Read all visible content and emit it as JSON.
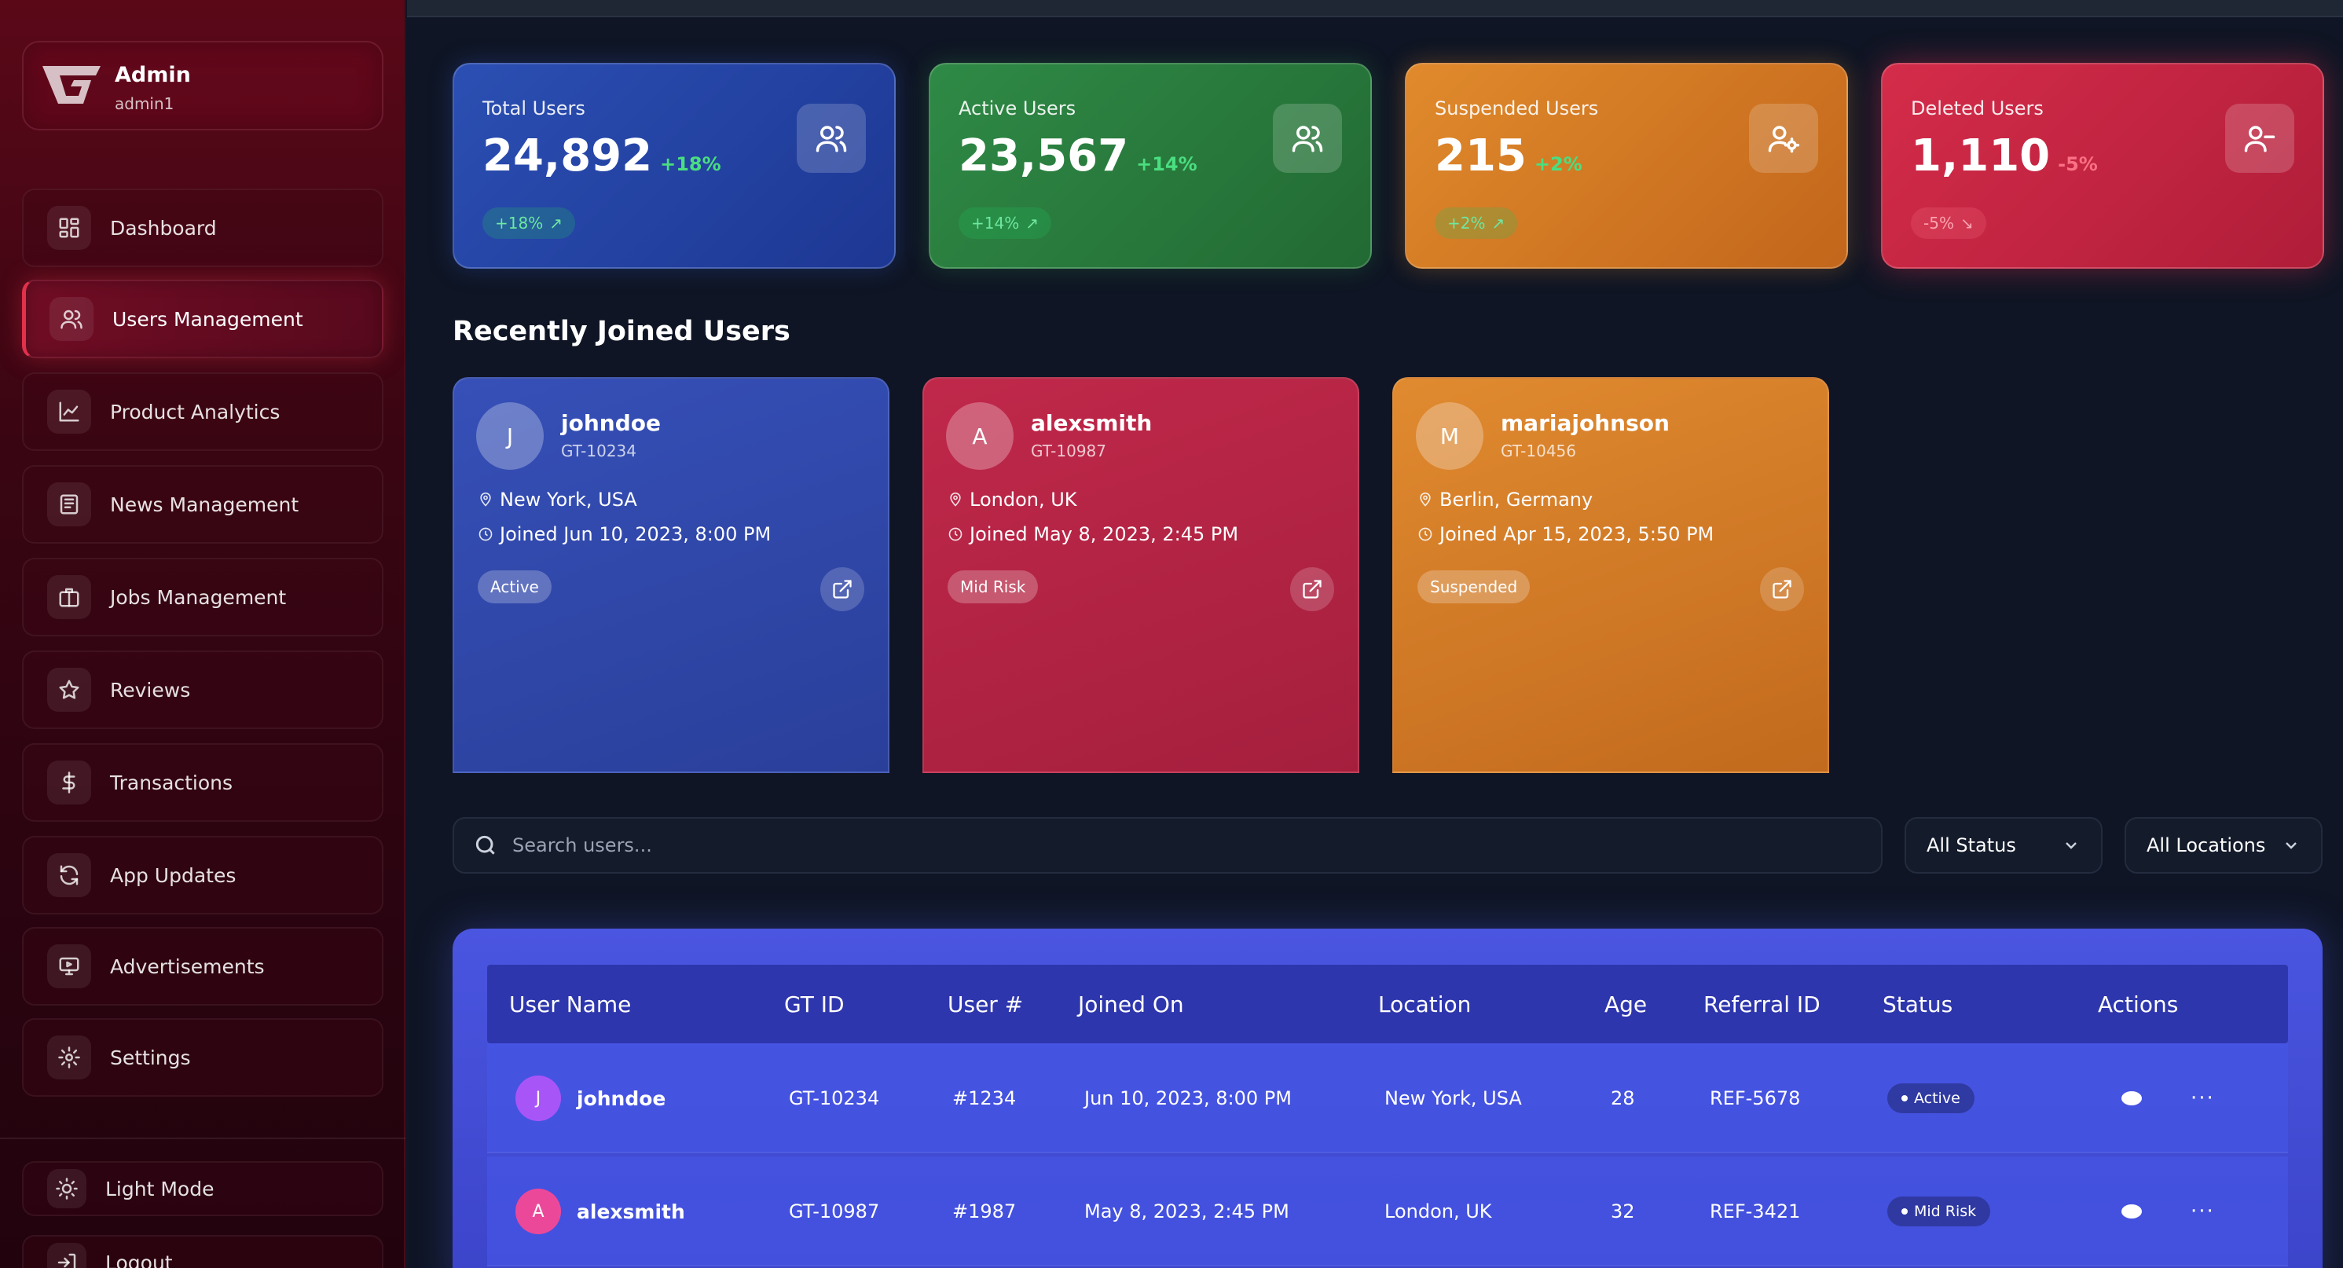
{
  "sidebar": {
    "profile": {
      "name": "Admin",
      "username": "admin1"
    },
    "items": [
      {
        "label": "Dashboard",
        "icon": "grid-icon"
      },
      {
        "label": "Users Management",
        "icon": "users-icon",
        "active": true
      },
      {
        "label": "Product Analytics",
        "icon": "chart-line-icon"
      },
      {
        "label": "News Management",
        "icon": "newspaper-icon"
      },
      {
        "label": "Jobs Management",
        "icon": "briefcase-icon"
      },
      {
        "label": "Reviews",
        "icon": "star-icon"
      },
      {
        "label": "Transactions",
        "icon": "dollar-icon"
      },
      {
        "label": "App Updates",
        "icon": "refresh-icon"
      },
      {
        "label": "Advertisements",
        "icon": "monitor-icon"
      },
      {
        "label": "Settings",
        "icon": "gear-icon"
      }
    ],
    "footer": [
      {
        "label": "Light Mode",
        "icon": "sun-icon"
      },
      {
        "label": "Logout",
        "icon": "logout-icon"
      }
    ]
  },
  "stats": [
    {
      "title": "Total Users",
      "value": "24,892",
      "delta": "+18%",
      "pill": "+18%",
      "trend": "up",
      "color": "#2b4fb3",
      "icon": "users-icon"
    },
    {
      "title": "Active Users",
      "value": "23,567",
      "delta": "+14%",
      "pill": "+14%",
      "trend": "up",
      "color": "#2f8a46",
      "icon": "users-icon"
    },
    {
      "title": "Suspended Users",
      "value": "215",
      "delta": "+2%",
      "pill": "+2%",
      "trend": "up",
      "color": "#e08a2c",
      "icon": "user-gear-icon"
    },
    {
      "title": "Deleted Users",
      "value": "1,110",
      "delta": "-5%",
      "pill": "-5%",
      "trend": "down",
      "color": "#d42c4a",
      "icon": "user-minus-icon"
    }
  ],
  "recent": {
    "title": "Recently Joined Users",
    "users": [
      {
        "initial": "J",
        "name": "johndoe",
        "gt_id": "GT-10234",
        "location": "New York, USA",
        "joined": "Joined Jun 10, 2023, 8:00 PM",
        "badge": "Active"
      },
      {
        "initial": "A",
        "name": "alexsmith",
        "gt_id": "GT-10987",
        "location": "London, UK",
        "joined": "Joined May 8, 2023, 2:45 PM",
        "badge": "Mid Risk"
      },
      {
        "initial": "M",
        "name": "mariajohnson",
        "gt_id": "GT-10456",
        "location": "Berlin, Germany",
        "joined": "Joined Apr 15, 2023, 5:50 PM",
        "badge": "Suspended"
      }
    ]
  },
  "search": {
    "placeholder": "Search users..."
  },
  "filters": {
    "status": "All Status",
    "location": "All Locations"
  },
  "table": {
    "headers": [
      "User Name",
      "GT ID",
      "User #",
      "Joined On",
      "Location",
      "Age",
      "Referral ID",
      "Status",
      "Actions"
    ],
    "rows": [
      {
        "initial": "J",
        "avatar_color": "#a855f7",
        "name": "johndoe",
        "gt_id": "GT-10234",
        "user_no": "#1234",
        "joined": "Jun 10, 2023, 8:00 PM",
        "location": "New York, USA",
        "age": "28",
        "referral": "REF-5678",
        "status": "Active",
        "more": "···"
      },
      {
        "initial": "A",
        "avatar_color": "#ec4899",
        "name": "alexsmith",
        "gt_id": "GT-10987",
        "user_no": "#1987",
        "joined": "May 8, 2023, 2:45 PM",
        "location": "London, UK",
        "age": "32",
        "referral": "REF-3421",
        "status": "Mid Risk",
        "more": "···"
      }
    ]
  }
}
